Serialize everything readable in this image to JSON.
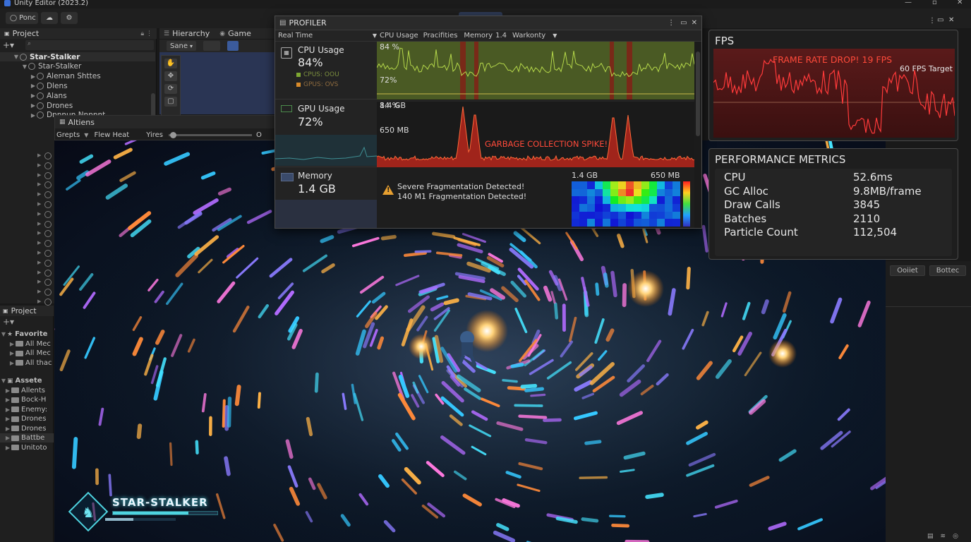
{
  "window": {
    "title": "Unity Editor (2023.2)"
  },
  "toolbar": {
    "ponc_label": "Ponc"
  },
  "project_top": {
    "tab": "Project"
  },
  "hierarchy": {
    "tab_hierarchy": "Hierarchy",
    "tab_game": "Game",
    "dropdown": "Sane",
    "items": [
      {
        "label": "Star-Stalker",
        "indent": 0,
        "selected": true
      },
      {
        "label": "Star-Stalker",
        "indent": 1
      },
      {
        "label": "Aleman Shttes",
        "indent": 2
      },
      {
        "label": "Dlens",
        "indent": 2
      },
      {
        "label": "Alans",
        "indent": 2
      },
      {
        "label": "Drones",
        "indent": 2
      },
      {
        "label": "Dnnnun Nnnnnt",
        "indent": 2
      }
    ]
  },
  "altiens_window": {
    "title": "Altiens",
    "opt1": "Grepts",
    "opt2": "Flew Heat",
    "opt3": "Yires",
    "slider_end": "O",
    "slider_value": 0.05
  },
  "project_bottom": {
    "tab": "Project",
    "favorites": "Favorite",
    "fav_items": [
      "All Mec",
      "All Mec",
      "All thac"
    ],
    "assets": "Assete",
    "asset_items": [
      "Allents",
      "Bock-H",
      "Enemy:",
      "Drones",
      "Drones",
      "Battbe",
      "Unitoto"
    ]
  },
  "profiler": {
    "title": "PROFILER",
    "mode": "Real Time",
    "tabs": [
      "CPU Usage",
      "Pracifities",
      "Memory",
      "1.4",
      "Warkonty"
    ],
    "cpu": {
      "title": "CPU Usage",
      "value": "84%",
      "legend1": "CPUS: OOU",
      "legend2": "GPUS: OVS",
      "top_label": "84 %",
      "mid_label": "72%"
    },
    "gpu": {
      "title": "GPU Usage",
      "value": "72%",
      "top_label": "1.4 GB",
      "mid_label": "650 MB",
      "annotation": "GARBAGE COLLECTION SPIKE!"
    },
    "memory": {
      "title": "Memory",
      "value": "1.4 GB",
      "warning1": "Severe Fragmentation Detected!",
      "warning2": "140 M1 Fragmentation Detected!",
      "heat_label_left": "1.4 GB",
      "heat_label_right": "650 MB"
    }
  },
  "fps": {
    "title": "FPS",
    "alert": "FRAME RATE DROP! 19 FPS",
    "target_label": "60 FPS Target"
  },
  "metrics": {
    "title": "PERFORMANCE METRICS",
    "rows": [
      {
        "name": "CPU",
        "value": "52.6ms"
      },
      {
        "name": "GC Alloc",
        "value": "9.8MB/frame"
      },
      {
        "name": "Draw Calls",
        "value": "3845"
      },
      {
        "name": "Batches",
        "value": "2110"
      },
      {
        "name": "Particle Count",
        "value": "112,504"
      }
    ]
  },
  "right_strip": {
    "btn1": "Ooiiet",
    "btn2": "Bottec"
  },
  "game_hud": {
    "player_name": "STAR-STALKER",
    "health": 0.72,
    "energy": 0.4
  },
  "colors": {
    "accent": "#e03a2c",
    "cpu_green": "#7fa832",
    "panel": "#1e1e1e",
    "alert_red": "#ff4a3a"
  }
}
